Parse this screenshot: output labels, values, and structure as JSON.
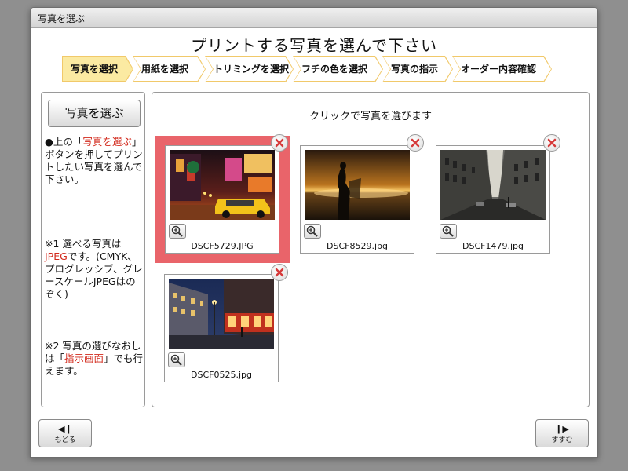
{
  "window": {
    "title": "写真を選ぶ"
  },
  "heading": "プリントする写真を選んで下さい",
  "steps": [
    {
      "label": "写真を選択",
      "active": true
    },
    {
      "label": "用紙を選択",
      "active": false
    },
    {
      "label": "トリミングを選択",
      "active": false
    },
    {
      "label": "フチの色を選択",
      "active": false
    },
    {
      "label": "写真の指示",
      "active": false
    },
    {
      "label": "オーダー内容確認",
      "active": false
    }
  ],
  "sidebar": {
    "choose_button": "写真を選ぶ",
    "para1": {
      "a": "●上の「",
      "b": "写真を選ぶ",
      "c": "」ボタンを押してプリントしたい写真を選んで下さい。"
    },
    "para2": {
      "a": "※1 選べる写真は",
      "b": "JPEG",
      "c": "です。(CMYK、プログレッシブ、グレースケールJPEGはのぞく)"
    },
    "para3": {
      "a": "※2 写真の選びなおしは「",
      "b": "指示画面",
      "c": "」でも行えます。"
    }
  },
  "main": {
    "caption": "クリックで写真を選びます",
    "photos": [
      {
        "filename": "DSCF5729.JPG",
        "selected": true,
        "icon": "delete-icon"
      },
      {
        "filename": "DSCF8529.jpg",
        "selected": false,
        "icon": "delete-icon"
      },
      {
        "filename": "DSCF1479.jpg",
        "selected": false,
        "icon": "delete-icon"
      },
      {
        "filename": "DSCF0525.jpg",
        "selected": false,
        "icon": "delete-icon"
      }
    ]
  },
  "footer": {
    "back": {
      "label": "もどる",
      "icon": "back-icon"
    },
    "next": {
      "label": "すすむ",
      "icon": "next-icon"
    }
  },
  "colors": {
    "selection": "#e9646a",
    "step_active": "#fbeaa2",
    "step_border": "#f1c96a",
    "accent_red": "#d2281b"
  }
}
